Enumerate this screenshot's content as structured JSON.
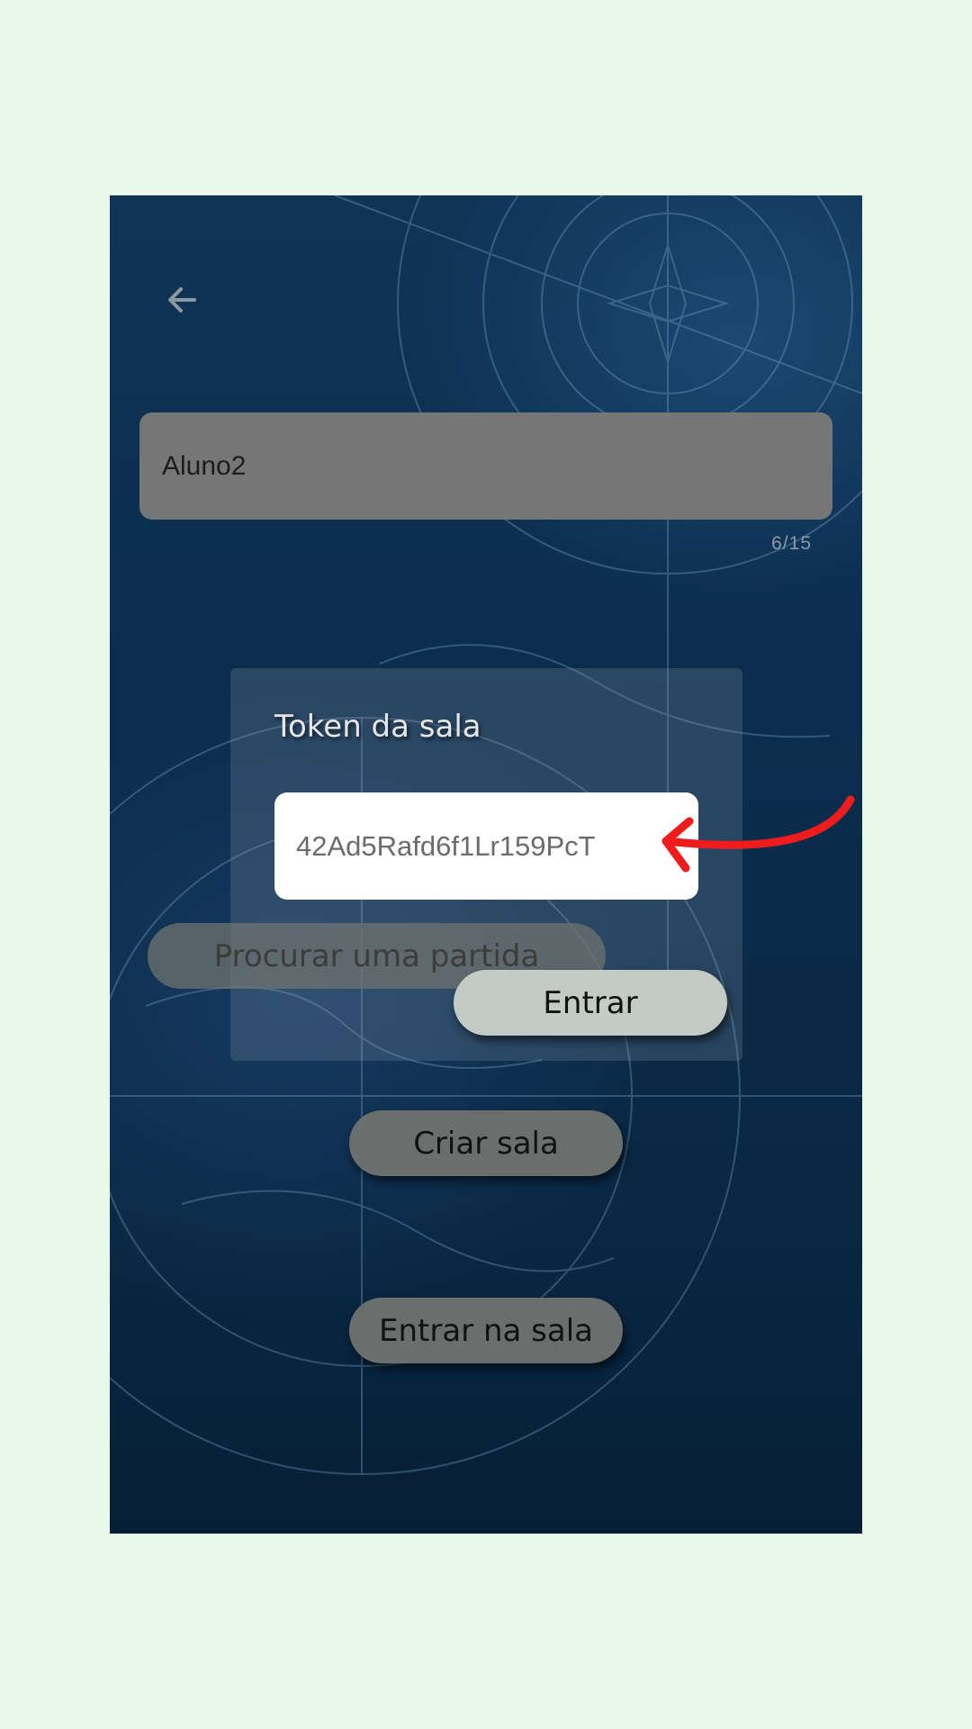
{
  "colors": {
    "page_background": "#e8f8e8",
    "screen_background": "#0b2d4d",
    "annotation_arrow": "#ee1c1c",
    "enter_button": "#c3cbc5",
    "pill_button": "#6a6f6d"
  },
  "header": {
    "back_icon": "arrow-left-icon"
  },
  "player_name": {
    "value": "Aluno2",
    "char_count": "6/15"
  },
  "token_dialog": {
    "title": "Token da sala",
    "token_value": "42Ad5Rafd6f1Lr159PcT",
    "search_match_label": "Procurar uma partida",
    "enter_label": "Entrar"
  },
  "actions": {
    "create_room_label": "Criar sala",
    "join_room_label": "Entrar na sala"
  },
  "annotation": {
    "icon": "curved-arrow-icon"
  }
}
